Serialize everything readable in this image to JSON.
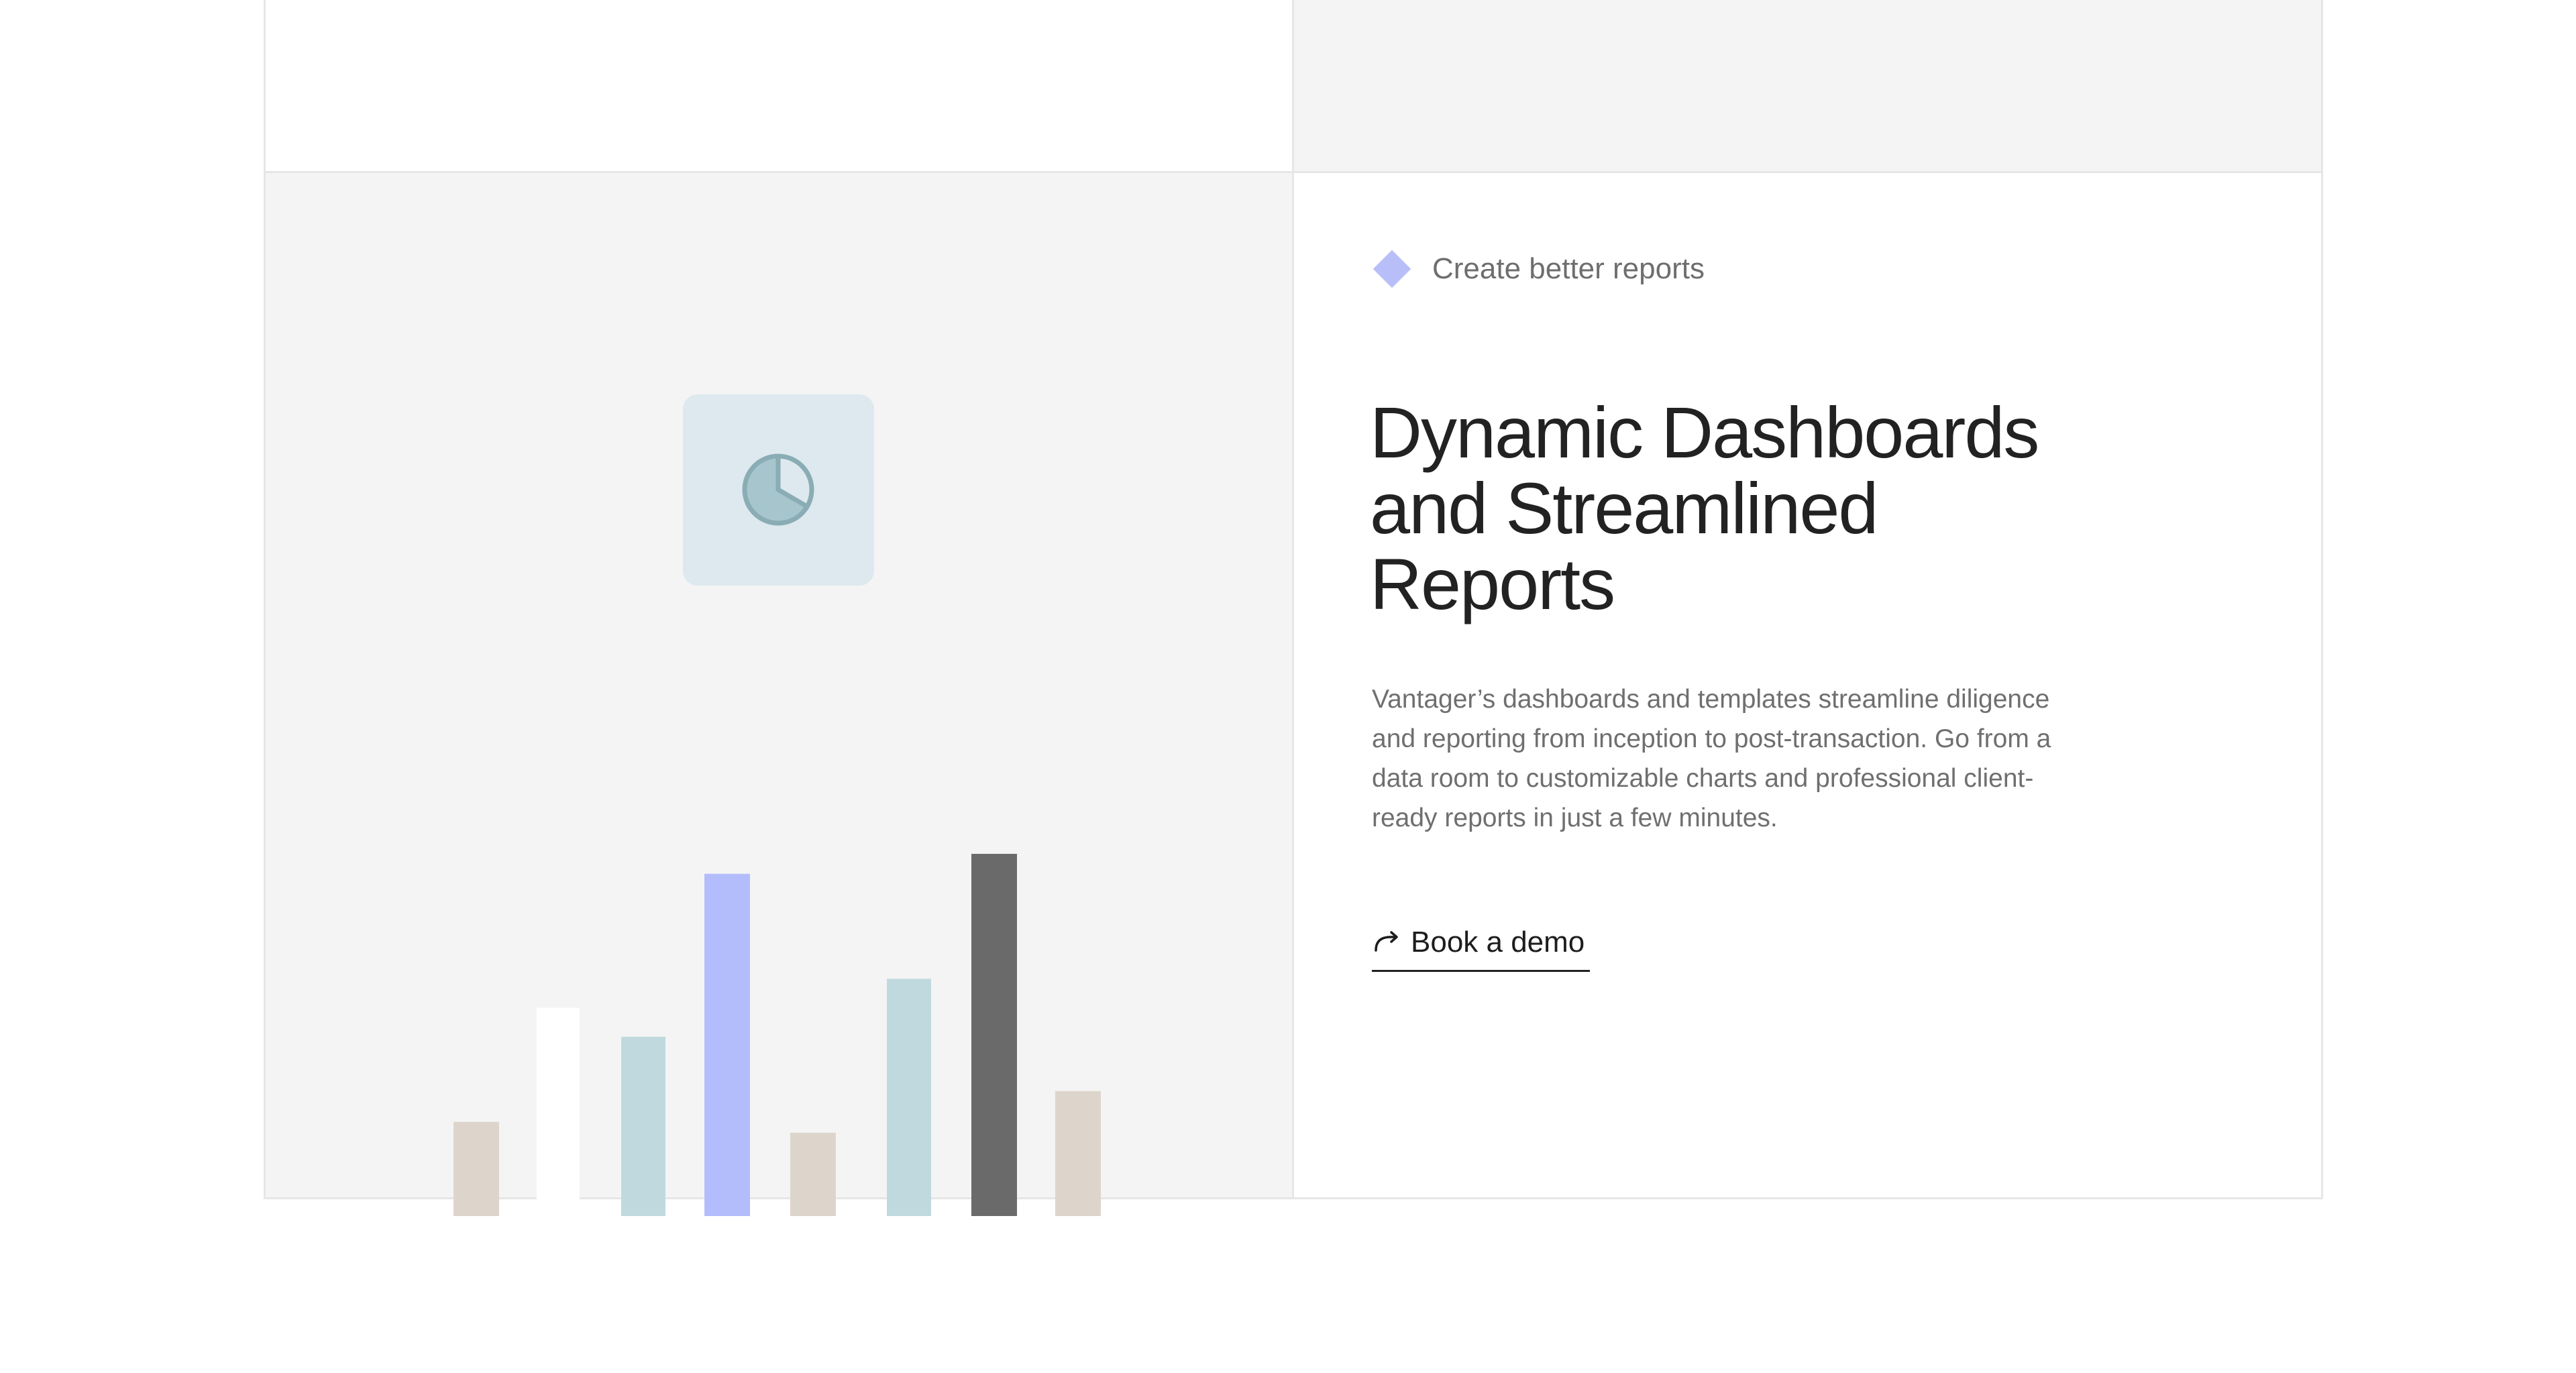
{
  "feature": {
    "eyebrow": "Create better reports",
    "headline": "Dynamic Dashboards\nand Streamlined\nReports",
    "description": "Vantager’s dashboards and templates streamline diligence and reporting from inception to post-transaction. Go from a data room to customizable charts and professional client-ready reports in just a few minutes.",
    "cta_label": "Book a demo",
    "cta_icon": "arrow-redirect-icon",
    "eyebrow_icon": "diamond-icon",
    "accent_color": "#b8bff8"
  },
  "illustration": {
    "tile_icon": "pie-chart-icon",
    "tile_color": "#dde9ee",
    "bars": [
      {
        "value": 0.26,
        "color": "#ddd5cc"
      },
      {
        "value": 0.575,
        "color": "#ffffff"
      },
      {
        "value": 0.495,
        "color": "#c0d9df"
      },
      {
        "value": 0.945,
        "color": "#b4bdfb"
      },
      {
        "value": 0.23,
        "color": "#ddd5cc"
      },
      {
        "value": 0.655,
        "color": "#c0d9df"
      },
      {
        "value": 1.0,
        "color": "#6a6a6a"
      },
      {
        "value": 0.345,
        "color": "#ddd5cc"
      }
    ]
  }
}
